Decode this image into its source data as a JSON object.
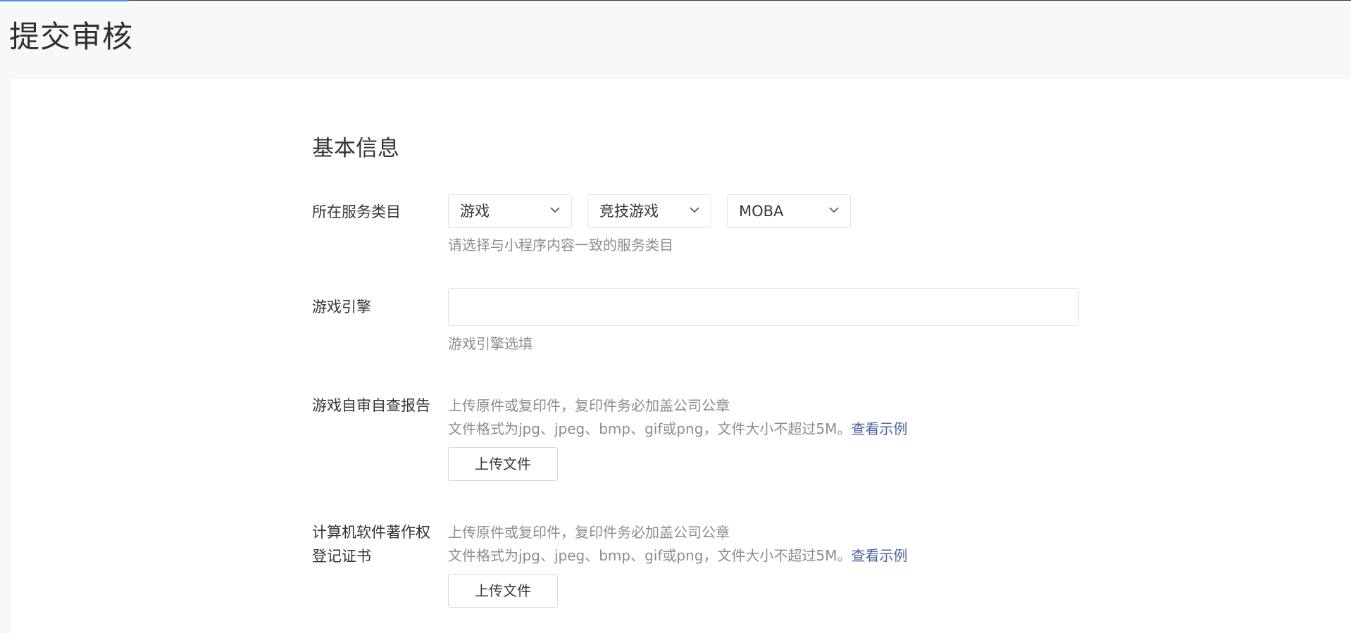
{
  "page": {
    "title": "提交审核"
  },
  "section": {
    "title": "基本信息"
  },
  "service_category": {
    "label": "所在服务类目",
    "selects": [
      {
        "value": "游戏"
      },
      {
        "value": "竞技游戏"
      },
      {
        "value": "MOBA"
      }
    ],
    "hint": "请选择与小程序内容一致的服务类目"
  },
  "game_engine": {
    "label": "游戏引擎",
    "value": "",
    "hint": "游戏引擎选填"
  },
  "self_check_report": {
    "label": "游戏自审自查报告",
    "hint_line1": "上传原件或复印件，复印件务必加盖公司公章",
    "hint_line2": "文件格式为jpg、jpeg、bmp、gif或png，文件大小不超过5M。",
    "example_link": "查看示例",
    "upload_label": "上传文件"
  },
  "software_copyright": {
    "label_line1": "计算机软件著作权",
    "label_line2": "登记证书",
    "hint_line1": "上传原件或复印件，复印件务必加盖公司公章",
    "hint_line2": "文件格式为jpg、jpeg、bmp、gif或png，文件大小不超过5M。",
    "example_link": "查看示例",
    "upload_label": "上传文件"
  },
  "icons": {
    "dropdown": "chevron-down-icon"
  },
  "colors": {
    "accent": "#4a90e2",
    "link": "#4a64a4",
    "hint": "#8d8d8d"
  }
}
